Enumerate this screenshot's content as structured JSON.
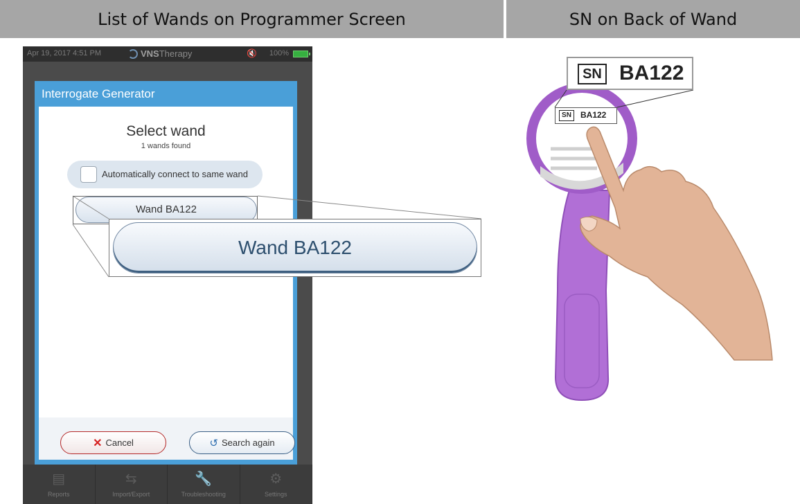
{
  "headers": {
    "left": "List of Wands on Programmer Screen",
    "right": "SN on Back of Wand"
  },
  "status_bar": {
    "datetime": "Apr 19, 2017  4:51 PM",
    "brand_bold": "VNS",
    "brand_light": "Therapy",
    "battery": "100%"
  },
  "dialog": {
    "title": "Interrogate Generator",
    "heading": "Select wand",
    "subheading": "1 wands found",
    "auto_connect_label": "Automatically connect to same wand",
    "wand_button_label": "Wand BA122",
    "cancel_label": "Cancel",
    "search_again_label": "Search again"
  },
  "zoom": {
    "wand_button_label": "Wand BA122"
  },
  "tabbar": {
    "items": [
      {
        "label": "Reports",
        "icon": "document-icon"
      },
      {
        "label": "Import/Export",
        "icon": "import-export-icon"
      },
      {
        "label": "Troubleshooting",
        "icon": "wrench-icon"
      },
      {
        "label": "Settings",
        "icon": "gears-icon"
      }
    ]
  },
  "wand_illustration": {
    "sn_label": "SN",
    "sn_value": "BA122",
    "colors": {
      "wand": "#b16fd6",
      "lens_rim": "#a05cc8",
      "skin": "#e2b497"
    }
  }
}
